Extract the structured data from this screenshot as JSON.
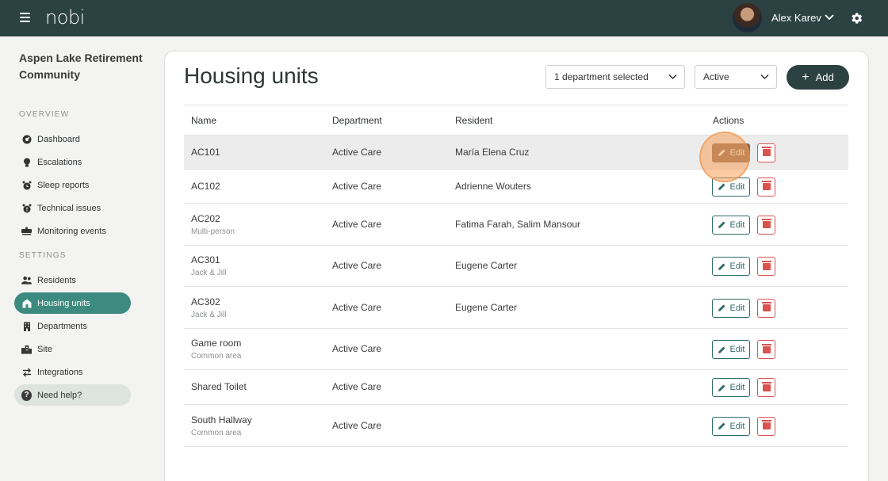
{
  "app": {
    "logo": "nobi"
  },
  "user": {
    "name": "Alex Karev"
  },
  "sidebar": {
    "org_name": "Aspen Lake Retirement Community",
    "overview_label": "OVERVIEW",
    "settings_label": "SETTINGS",
    "overview_items": [
      {
        "label": "Dashboard",
        "icon": "dashboard-icon"
      },
      {
        "label": "Escalations",
        "icon": "bulb-icon"
      },
      {
        "label": "Sleep reports",
        "icon": "alarm-clock-icon"
      },
      {
        "label": "Technical issues",
        "icon": "alert-clock-icon"
      },
      {
        "label": "Monitoring events",
        "icon": "monitoring-icon"
      }
    ],
    "settings_items": [
      {
        "label": "Residents",
        "icon": "people-icon"
      },
      {
        "label": "Housing units",
        "icon": "house-icon",
        "active": true
      },
      {
        "label": "Departments",
        "icon": "building-icon"
      },
      {
        "label": "Site",
        "icon": "city-icon"
      },
      {
        "label": "Integrations",
        "icon": "arrows-icon"
      }
    ],
    "help_label": "Need help?"
  },
  "main": {
    "title": "Housing units",
    "department_filter": "1 department selected",
    "status_filter": "Active",
    "add_label": "Add",
    "columns": [
      "Name",
      "Department",
      "Resident",
      "Actions"
    ],
    "edit_label": "Edit",
    "rows": [
      {
        "name": "AC101",
        "sub": "",
        "department": "Active Care",
        "resident": "María Elena Cruz"
      },
      {
        "name": "AC102",
        "sub": "",
        "department": "Active Care",
        "resident": "Adrienne Wouters"
      },
      {
        "name": "AC202",
        "sub": "Multi-person",
        "department": "Active Care",
        "resident": "Fatima Farah, Salim Mansour"
      },
      {
        "name": "AC301",
        "sub": "Jack & Jill",
        "department": "Active Care",
        "resident": "Eugene Carter"
      },
      {
        "name": "AC302",
        "sub": "Jack & Jill",
        "department": "Active Care",
        "resident": "Eugene Carter"
      },
      {
        "name": "Game room",
        "sub": "Common area",
        "department": "Active Care",
        "resident": ""
      },
      {
        "name": "Shared Toilet",
        "sub": "",
        "department": "Active Care",
        "resident": ""
      },
      {
        "name": "South Hallway",
        "sub": "Common area",
        "department": "Active Care",
        "resident": ""
      }
    ]
  },
  "colors": {
    "topbar": "#2c4141",
    "accent": "#3c8a80",
    "danger": "#d9534f",
    "edit_active": "#8a6b52"
  }
}
